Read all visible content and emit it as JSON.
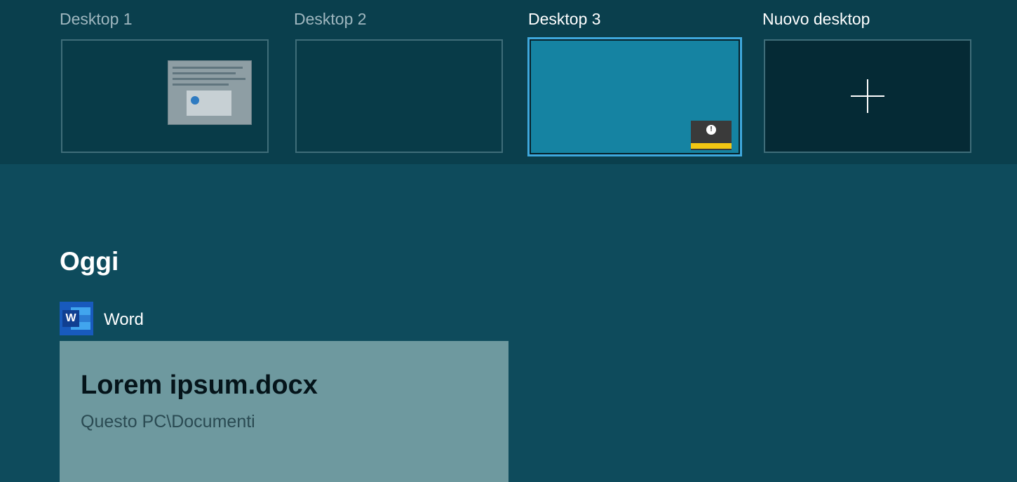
{
  "desktops": [
    {
      "label": "Desktop 1",
      "active": false
    },
    {
      "label": "Desktop 2",
      "active": false
    },
    {
      "label": "Desktop 3",
      "active": true
    }
  ],
  "new_desktop": {
    "label": "Nuovo desktop",
    "icon": "plus-icon"
  },
  "timeline": {
    "section_title": "Oggi",
    "app": {
      "name": "Word",
      "icon": "word-icon",
      "icon_letter": "W"
    },
    "document": {
      "title": "Lorem ipsum.docx",
      "path": "Questo PC\\Documenti"
    }
  },
  "colors": {
    "background": "#0e4b5c",
    "desktops_bar": "#0a3f4d",
    "active_border": "#3ea8dd",
    "active_desktop_fill": "#1583a2",
    "card": "#6e999f",
    "word_blue": "#185abd"
  }
}
